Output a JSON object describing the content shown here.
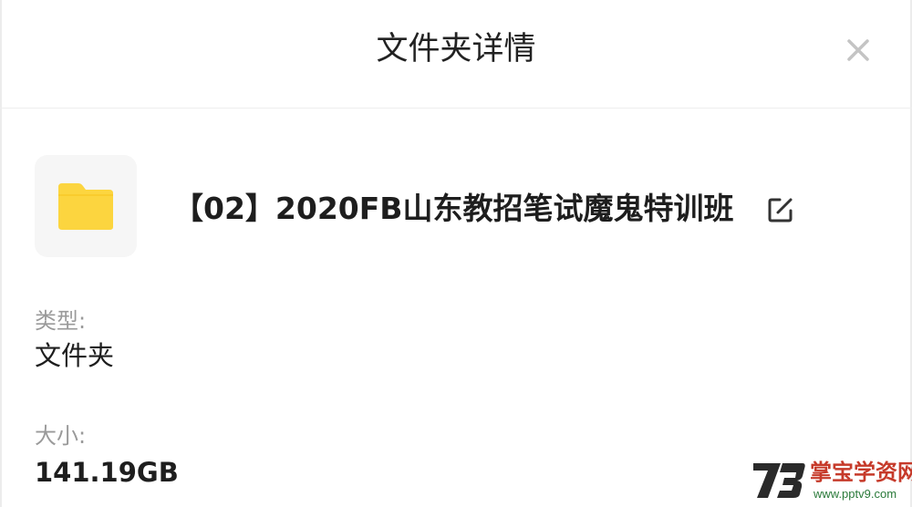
{
  "dialog": {
    "title": "文件夹详情"
  },
  "icons": {
    "close": "close-icon",
    "folder": "folder-icon",
    "edit": "edit-icon"
  },
  "colors": {
    "folder_yellow": "#fcd53f",
    "tile_background": "#f6f6f6",
    "label_gray": "#9a9a9a",
    "text_dark": "#1e1e1e"
  },
  "folder": {
    "name": "【02】2020FB山东教招笔试魔鬼特训班"
  },
  "fields": {
    "type_label": "类型:",
    "type_value": "文件夹",
    "size_label": "大小:",
    "size_value": "141.19GB"
  },
  "watermark": {
    "name": "掌宝学资网",
    "url": "www.pptv9.com"
  }
}
